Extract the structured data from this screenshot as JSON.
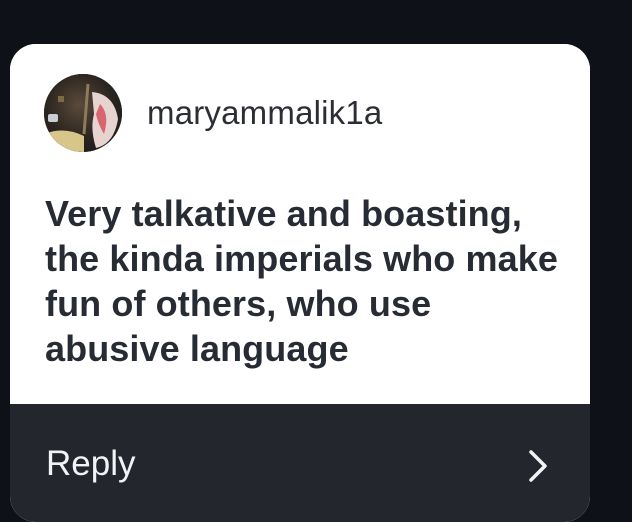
{
  "card": {
    "username": "maryammalik1a",
    "question": "Very talkative and boasting, the kinda imperials who make fun of others, who use abusive language",
    "avatar_icon": "profile-photo"
  },
  "reply": {
    "label": "Reply",
    "icon": "chevron-right-icon"
  },
  "colors": {
    "background": "#0e1117",
    "card": "#ffffff",
    "reply_bar": "#23272d",
    "text_dark": "#272b33",
    "text_light": "#f2f3f5"
  }
}
